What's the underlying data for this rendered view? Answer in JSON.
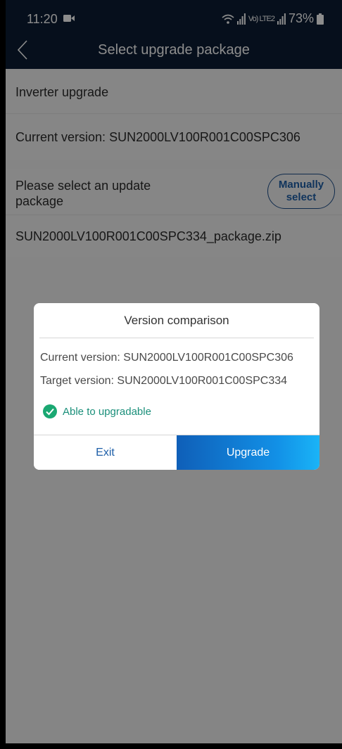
{
  "status_bar": {
    "time": "11:20",
    "network": "Vo) LTE2",
    "battery": "73%"
  },
  "header": {
    "title": "Select upgrade package"
  },
  "content": {
    "section_title": "Inverter upgrade",
    "current_version_label": "Current version:",
    "current_version_value": "SUN2000LV100R001C00SPC306",
    "select_prompt": "Please select an update package",
    "manual_select_button": "Manually select",
    "package_file": "SUN2000LV100R001C00SPC334_package.zip"
  },
  "dialog": {
    "title": "Version comparison",
    "current_label": "Current version:",
    "current_value": "SUN2000LV100R001C00SPC306",
    "target_label": "Target version:",
    "target_value": "SUN2000LV100R001C00SPC334",
    "status_text": "Able to upgradable",
    "exit_button": "Exit",
    "upgrade_button": "Upgrade"
  },
  "colors": {
    "header_bg": "#0c1d33",
    "accent_blue": "#1e5fa8",
    "success_green": "#1aa872"
  }
}
